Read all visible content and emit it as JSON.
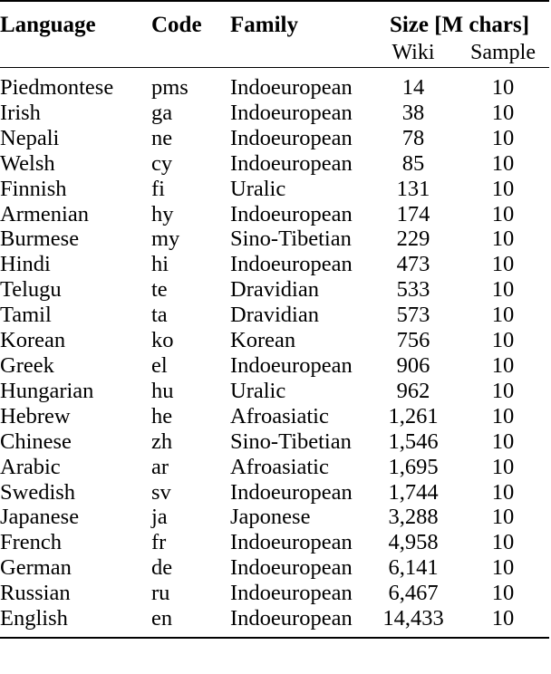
{
  "table": {
    "caption": "",
    "headers": {
      "language": "Language",
      "code": "Code",
      "family": "Family",
      "size_group": "Size [M chars]",
      "wiki": "Wiki",
      "sample": "Sample"
    },
    "columns": [
      "Language",
      "Code",
      "Family",
      "Wiki",
      "Sample"
    ],
    "rows": [
      {
        "language": "Piedmontese",
        "code": "pms",
        "family": "Indoeuropean",
        "wiki": "14",
        "sample": "10"
      },
      {
        "language": "Irish",
        "code": "ga",
        "family": "Indoeuropean",
        "wiki": "38",
        "sample": "10"
      },
      {
        "language": "Nepali",
        "code": "ne",
        "family": "Indoeuropean",
        "wiki": "78",
        "sample": "10"
      },
      {
        "language": "Welsh",
        "code": "cy",
        "family": "Indoeuropean",
        "wiki": "85",
        "sample": "10"
      },
      {
        "language": "Finnish",
        "code": "fi",
        "family": "Uralic",
        "wiki": "131",
        "sample": "10"
      },
      {
        "language": "Armenian",
        "code": "hy",
        "family": "Indoeuropean",
        "wiki": "174",
        "sample": "10"
      },
      {
        "language": "Burmese",
        "code": "my",
        "family": "Sino-Tibetian",
        "wiki": "229",
        "sample": "10"
      },
      {
        "language": "Hindi",
        "code": "hi",
        "family": "Indoeuropean",
        "wiki": "473",
        "sample": "10"
      },
      {
        "language": "Telugu",
        "code": "te",
        "family": "Dravidian",
        "wiki": "533",
        "sample": "10"
      },
      {
        "language": "Tamil",
        "code": "ta",
        "family": "Dravidian",
        "wiki": "573",
        "sample": "10"
      },
      {
        "language": "Korean",
        "code": "ko",
        "family": "Korean",
        "wiki": "756",
        "sample": "10"
      },
      {
        "language": "Greek",
        "code": "el",
        "family": "Indoeuropean",
        "wiki": "906",
        "sample": "10"
      },
      {
        "language": "Hungarian",
        "code": "hu",
        "family": "Uralic",
        "wiki": "962",
        "sample": "10"
      },
      {
        "language": "Hebrew",
        "code": "he",
        "family": "Afroasiatic",
        "wiki": "1,261",
        "sample": "10"
      },
      {
        "language": "Chinese",
        "code": "zh",
        "family": "Sino-Tibetian",
        "wiki": "1,546",
        "sample": "10"
      },
      {
        "language": "Arabic",
        "code": "ar",
        "family": "Afroasiatic",
        "wiki": "1,695",
        "sample": "10"
      },
      {
        "language": "Swedish",
        "code": "sv",
        "family": "Indoeuropean",
        "wiki": "1,744",
        "sample": "10"
      },
      {
        "language": "Japanese",
        "code": "ja",
        "family": "Japonese",
        "wiki": "3,288",
        "sample": "10"
      },
      {
        "language": "French",
        "code": "fr",
        "family": "Indoeuropean",
        "wiki": "4,958",
        "sample": "10"
      },
      {
        "language": "German",
        "code": "de",
        "family": "Indoeuropean",
        "wiki": "6,141",
        "sample": "10"
      },
      {
        "language": "Russian",
        "code": "ru",
        "family": "Indoeuropean",
        "wiki": "6,467",
        "sample": "10"
      },
      {
        "language": "English",
        "code": "en",
        "family": "Indoeuropean",
        "wiki": "14,433",
        "sample": "10"
      }
    ]
  },
  "colors": {
    "text": "#000000",
    "background": "#ffffff",
    "rule": "#000000"
  }
}
